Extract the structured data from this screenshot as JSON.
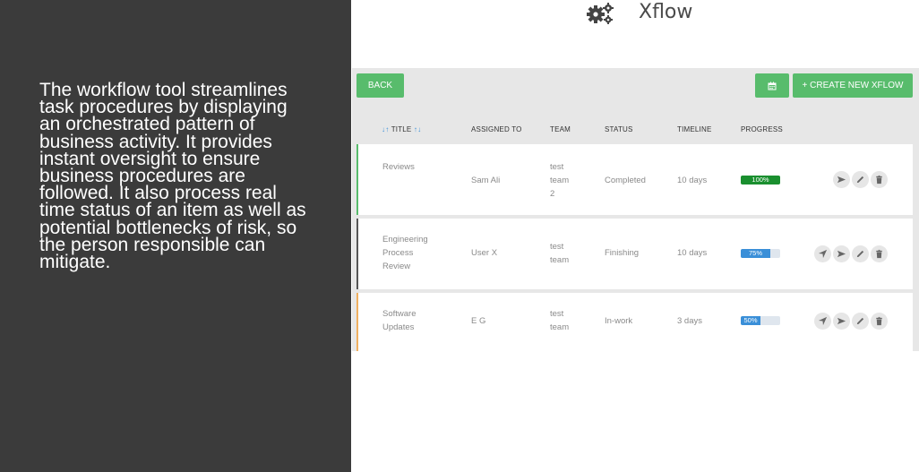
{
  "description": "The workflow tool streamlines task procedures by displaying an orchestrated pattern of business activity. It provides instant oversight to ensure business procedures are followed. It also process real time status of an item as well as potential bottlenecks of risk, so the person responsible can mitigate.",
  "header": {
    "title": "Xflow",
    "icon": "gears-icon"
  },
  "toolbar": {
    "back_label": "BACK",
    "calendar_icon": "calendar-icon",
    "create_label": "+ CREATE NEW XFLOW"
  },
  "columns": {
    "title": "TITLE",
    "assigned_to": "ASSIGNED TO",
    "team": "TEAM",
    "status": "STATUS",
    "timeline": "TIMELINE",
    "progress": "PROGRESS"
  },
  "rows": [
    {
      "title_lines": [
        "Reviews"
      ],
      "assigned": "Sam Ali",
      "team_lines": [
        "test",
        "team",
        "2"
      ],
      "status": "Completed",
      "timeline": "10 days",
      "progress": 1.0,
      "progress_label": "100%",
      "progress_color": "#1a8f2f",
      "border_color": "#58bc6c",
      "actions": [
        "send-icon",
        "edit-icon",
        "delete-icon"
      ]
    },
    {
      "title_lines": [
        "Engineering",
        "Process",
        "Review"
      ],
      "assigned": "User X",
      "team_lines": [
        "test",
        "team"
      ],
      "status": "Finishing",
      "timeline": "10 days",
      "progress": 0.75,
      "progress_label": "75%",
      "progress_color": "#3a8fd8",
      "border_color": "#555555",
      "actions": [
        "navigate-icon",
        "send-icon",
        "edit-icon",
        "delete-icon"
      ]
    },
    {
      "title_lines": [
        "Software",
        "Updates"
      ],
      "assigned": "E G",
      "team_lines": [
        "test",
        "team"
      ],
      "status": "In-work",
      "timeline": "3 days",
      "progress": 0.5,
      "progress_label": "50%",
      "progress_color": "#3a8fd8",
      "border_color": "#f0b060",
      "actions": [
        "navigate-icon",
        "send-icon",
        "edit-icon",
        "delete-icon"
      ]
    }
  ],
  "colors": {
    "left_panel": "#3b3b3b",
    "accent_green": "#58bc6c",
    "app_bg": "#e7e7e7"
  }
}
